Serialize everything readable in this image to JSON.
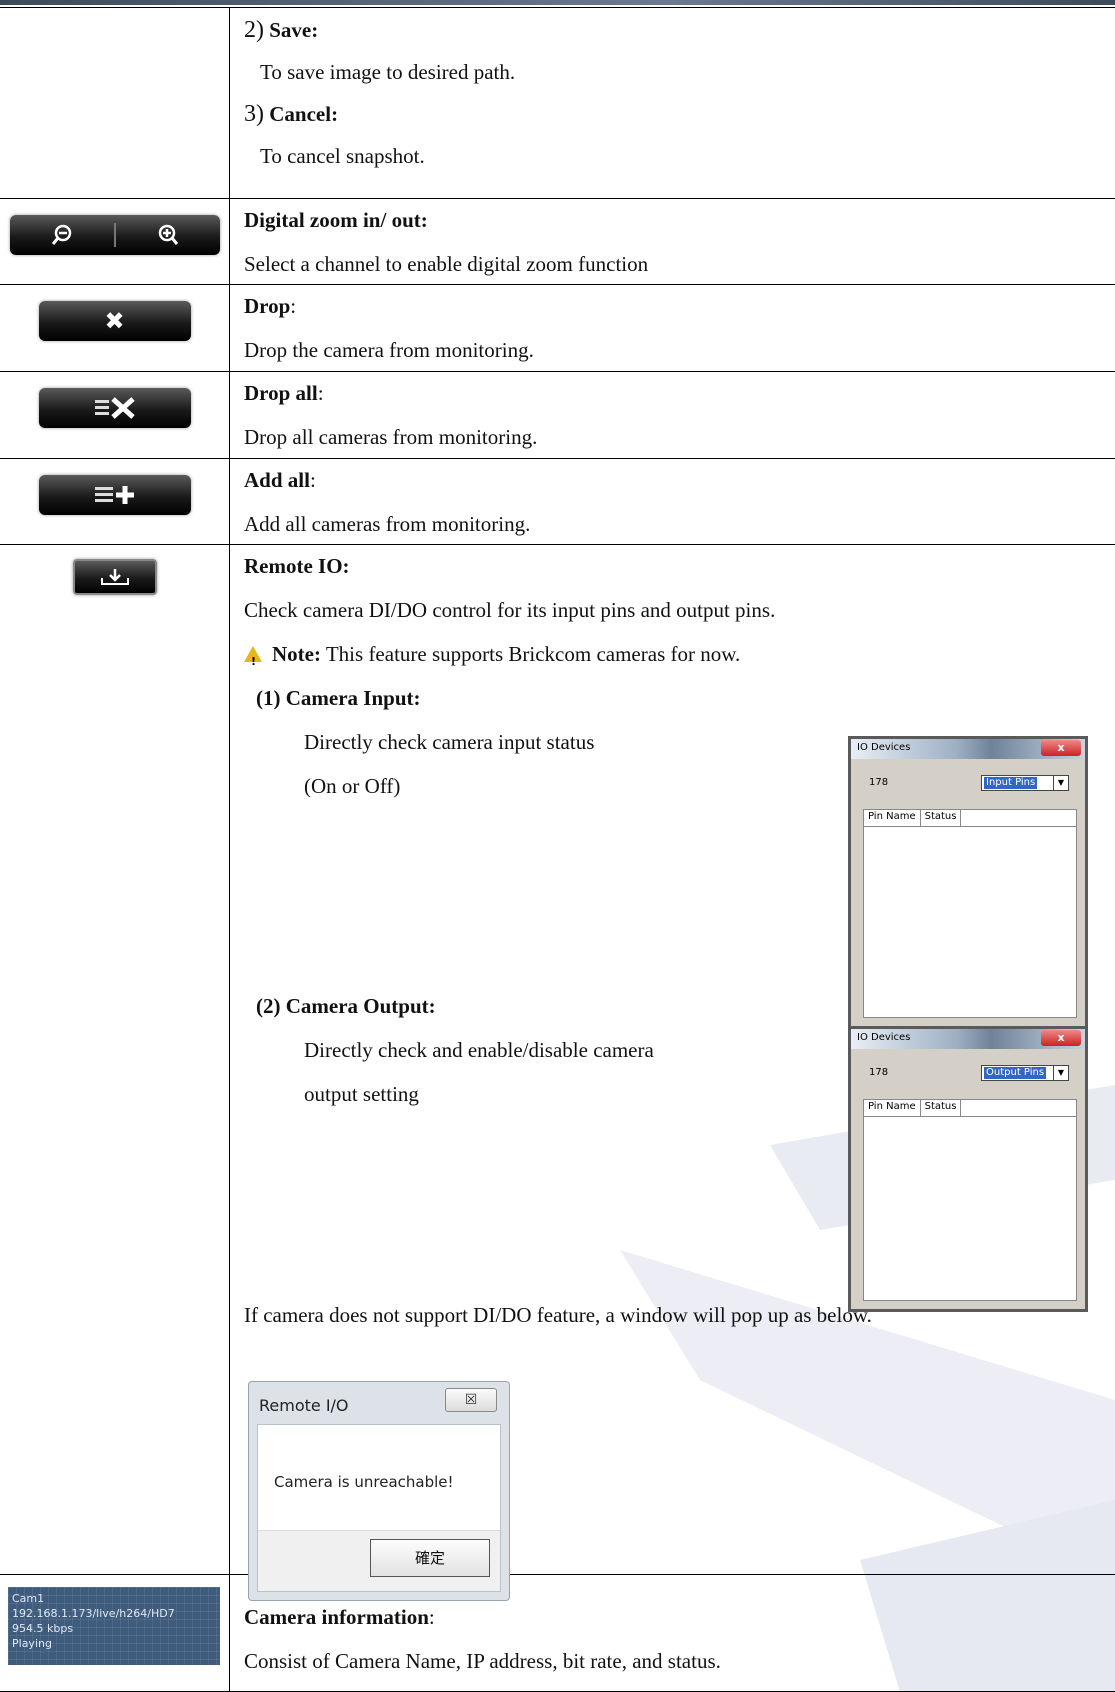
{
  "snapshot_row": {
    "save_num": "2)",
    "save_title": "Save:",
    "save_desc": "To save image to desired path.",
    "cancel_num": "3)",
    "cancel_title": "Cancel:",
    "cancel_desc": "To cancel snapshot."
  },
  "zoom_row": {
    "title": "Digital zoom in/ out:",
    "desc": "Select a channel to enable digital zoom function",
    "zoom_out_icon": "zoom-out-icon",
    "zoom_in_icon": "zoom-in-icon"
  },
  "drop_row": {
    "title": "Drop",
    "colon": ":",
    "desc": "Drop the camera from monitoring.",
    "icon": "close-icon"
  },
  "drop_all_row": {
    "title": "Drop all",
    "colon": ":",
    "desc": "Drop all cameras from monitoring.",
    "icon": "drop-all-icon"
  },
  "add_all_row": {
    "title": "Add all",
    "colon": ":",
    "desc": "Add all cameras from monitoring.",
    "icon": "add-all-icon"
  },
  "remote_io_row": {
    "title": "Remote IO:",
    "desc": "Check camera DI/DO control for its input pins and output pins.",
    "note_label": "Note:",
    "note_text": " This feature supports Brickcom cameras for now.",
    "input_title": "(1) Camera Input:",
    "input_desc_1": "Directly check camera input status",
    "input_desc_2": "(On or Off)",
    "output_title": "(2) Camera Output:",
    "output_desc_1": "Directly check and enable/disable camera",
    "output_desc_2": "output setting",
    "popup_desc": "If camera does not support DI/DO feature, a window will pop up as below.",
    "icon": "download-icon"
  },
  "io_window_input": {
    "title": "IO Devices",
    "close": "x",
    "number": "178",
    "select": "Input Pins",
    "col1": "Pin Name",
    "col2": "Status"
  },
  "io_window_output": {
    "title": "IO Devices",
    "close": "x",
    "number": "178",
    "select": "Output Pins",
    "col1": "Pin Name",
    "col2": "Status"
  },
  "remote_io_dialog": {
    "title": "Remote I/O",
    "close": "☒",
    "message": "Camera is unreachable!",
    "ok": "確定"
  },
  "camera_info_row": {
    "title": "Camera information",
    "colon": ":",
    "desc": "Consist of Camera Name, IP address, bit rate, and status.",
    "tile_lines": [
      "Cam1",
      "192.168.1.173/live/h264/HD7",
      "954.5 kbps",
      "Playing"
    ]
  }
}
